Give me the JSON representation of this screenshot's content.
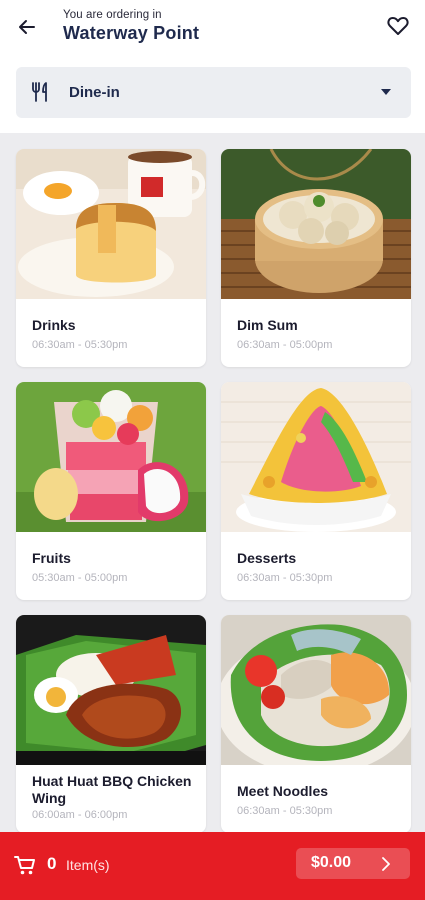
{
  "header": {
    "subtitle": "You are ordering in",
    "location": "Waterway Point",
    "icons": {
      "back": "arrow-left-icon",
      "favorite": "heart-outline-icon"
    }
  },
  "order_mode": {
    "label": "Dine-in",
    "icon": "utensils-icon"
  },
  "categories": [
    {
      "name": "Drinks",
      "hours": "06:30am - 05:30pm"
    },
    {
      "name": "Dim Sum",
      "hours": "06:30am - 05:00pm"
    },
    {
      "name": "Fruits",
      "hours": "05:30am - 05:00pm"
    },
    {
      "name": "Desserts",
      "hours": "06:30am - 05:30pm"
    },
    {
      "name": "Huat Huat BBQ Chicken Wing",
      "hours": "06:00am - 06:00pm"
    },
    {
      "name": "Meet Noodles",
      "hours": "06:30am - 05:30pm"
    }
  ],
  "cart": {
    "count": "0",
    "label": "Item(s)",
    "total": "$0.00",
    "icons": {
      "cart": "shopping-cart-icon",
      "proceed": "chevron-right-icon"
    }
  },
  "colors": {
    "accent": "#e51d24",
    "heading": "#1f2a4d",
    "background": "#ececef"
  }
}
